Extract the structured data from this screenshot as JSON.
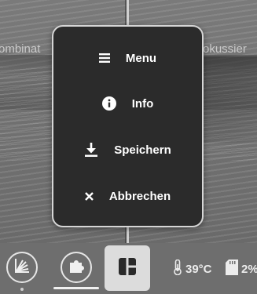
{
  "background": {
    "left_label": "ombinat",
    "right_label": "okussier"
  },
  "menu": {
    "items": [
      {
        "label": "Menu",
        "icon": "hamburger-icon"
      },
      {
        "label": "Info",
        "icon": "info-icon"
      },
      {
        "label": "Speichern",
        "icon": "download-icon"
      },
      {
        "label": "Abbrechen",
        "icon": "close-icon"
      }
    ]
  },
  "toolbar": {
    "temperature": "39°C",
    "storage": "2%",
    "buttons": [
      "exposure-icon",
      "puzzle-icon",
      "layout-icon"
    ]
  },
  "colors": {
    "menu_background": "#2b2b2b",
    "menu_border": "#d6d6d6",
    "text": "#ffffff",
    "active_button": "#dcdcdc"
  }
}
